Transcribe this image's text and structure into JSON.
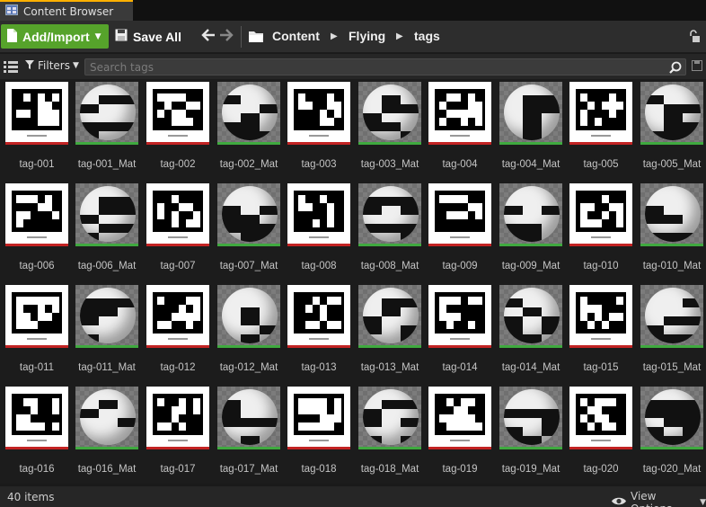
{
  "tab": {
    "title": "Content Browser",
    "icon": "content-browser-icon"
  },
  "toolbar": {
    "add_import_label": "Add/Import",
    "save_all_label": "Save All",
    "breadcrumbs": [
      "Content",
      "Flying",
      "tags"
    ]
  },
  "filterbar": {
    "filters_label": "Filters",
    "search_placeholder": "Search tags",
    "search_value": ""
  },
  "assets": [
    {
      "label": "tag-001",
      "kind": "texture"
    },
    {
      "label": "tag-001_Mat",
      "kind": "material"
    },
    {
      "label": "tag-002",
      "kind": "texture"
    },
    {
      "label": "tag-002_Mat",
      "kind": "material"
    },
    {
      "label": "tag-003",
      "kind": "texture"
    },
    {
      "label": "tag-003_Mat",
      "kind": "material"
    },
    {
      "label": "tag-004",
      "kind": "texture"
    },
    {
      "label": "tag-004_Mat",
      "kind": "material"
    },
    {
      "label": "tag-005",
      "kind": "texture"
    },
    {
      "label": "tag-005_Mat",
      "kind": "material"
    },
    {
      "label": "tag-006",
      "kind": "texture"
    },
    {
      "label": "tag-006_Mat",
      "kind": "material"
    },
    {
      "label": "tag-007",
      "kind": "texture"
    },
    {
      "label": "tag-007_Mat",
      "kind": "material"
    },
    {
      "label": "tag-008",
      "kind": "texture"
    },
    {
      "label": "tag-008_Mat",
      "kind": "material"
    },
    {
      "label": "tag-009",
      "kind": "texture"
    },
    {
      "label": "tag-009_Mat",
      "kind": "material"
    },
    {
      "label": "tag-010",
      "kind": "texture"
    },
    {
      "label": "tag-010_Mat",
      "kind": "material"
    },
    {
      "label": "tag-011",
      "kind": "texture"
    },
    {
      "label": "tag-011_Mat",
      "kind": "material"
    },
    {
      "label": "tag-012",
      "kind": "texture"
    },
    {
      "label": "tag-012_Mat",
      "kind": "material"
    },
    {
      "label": "tag-013",
      "kind": "texture"
    },
    {
      "label": "tag-013_Mat",
      "kind": "material"
    },
    {
      "label": "tag-014",
      "kind": "texture"
    },
    {
      "label": "tag-014_Mat",
      "kind": "material"
    },
    {
      "label": "tag-015",
      "kind": "texture"
    },
    {
      "label": "tag-015_Mat",
      "kind": "material"
    },
    {
      "label": "tag-016",
      "kind": "texture"
    },
    {
      "label": "tag-016_Mat",
      "kind": "material"
    },
    {
      "label": "tag-017",
      "kind": "texture"
    },
    {
      "label": "tag-017_Mat",
      "kind": "material"
    },
    {
      "label": "tag-018",
      "kind": "texture"
    },
    {
      "label": "tag-018_Mat",
      "kind": "material"
    },
    {
      "label": "tag-019",
      "kind": "texture"
    },
    {
      "label": "tag-019_Mat",
      "kind": "material"
    },
    {
      "label": "tag-020",
      "kind": "texture"
    },
    {
      "label": "tag-020_Mat",
      "kind": "material"
    }
  ],
  "status": {
    "item_count": "40 items",
    "view_options_label": "View Options"
  },
  "colors": {
    "accent_tab": "#ffb000",
    "add_button": "#56a32b",
    "texture_bar": "#c22323",
    "material_bar": "#3fa93f"
  }
}
